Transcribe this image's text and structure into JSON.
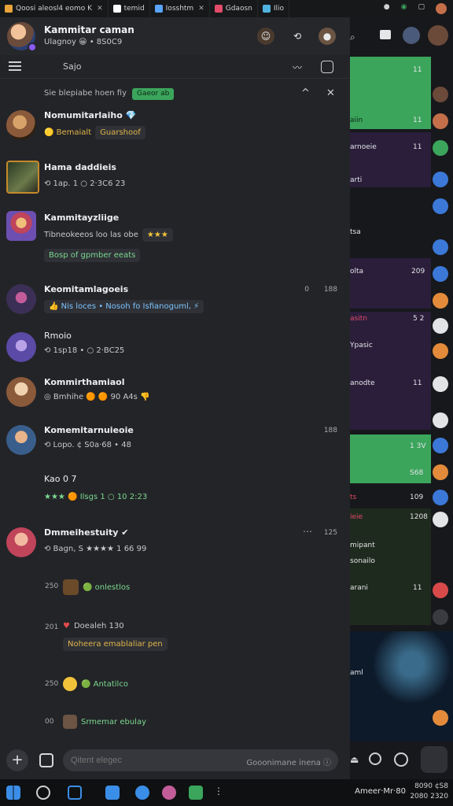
{
  "tabs": [
    {
      "label": "Qoosi aleosl4 eomo K",
      "color": "#e8a33a",
      "closable": true
    },
    {
      "label": "temid",
      "color": "#ffffff",
      "closable": false
    },
    {
      "label": "Iosshtm",
      "color": "#5aa3ff",
      "closable": true
    },
    {
      "label": "Gdaosn",
      "color": "#e34b6a",
      "closable": false
    },
    {
      "label": "Ilio",
      "color": "#4fb3e0",
      "closable": false
    }
  ],
  "header": {
    "title": "Kammitar caman",
    "subtitle": "Ulagnoy 😀 • 8S0C9",
    "buttons": [
      "user-icon",
      "link-icon",
      "profile-icon"
    ]
  },
  "toolbar": {
    "label": "Sajo"
  },
  "filter": {
    "label": "Sie blepiabe hoen fiy",
    "chip": "Gaeor ab",
    "collapse": "^",
    "close": "✕"
  },
  "messages": [
    {
      "name": "Nomumitarlaiho 💎",
      "line": "🟡 Bemaialt",
      "pill": "Guarshoof",
      "avatar": "#8a5a3a"
    },
    {
      "name": "Hama daddieis",
      "line": "⟲ 1ap. 1   ○ 2·3C6 23",
      "avatar": "#3b4a2c"
    },
    {
      "name": "Kammitayzliige",
      "line": "Tibneokeeos loo las obe",
      "pill": "Bosp of gpmber eeats",
      "avatar": "#6c4fb0"
    },
    {
      "name": "Keomitamlagoeis",
      "line": "👍 Nis loces • Nosoh fo Isfianoguml, ⚡",
      "time_a": "0",
      "time_b": "188",
      "avatar": "#3b2f56"
    },
    {
      "name": "Rmoio",
      "line": "⟲ 1sp18 •  ○ 2·BC25",
      "avatar": "#5b4aa6"
    },
    {
      "name": "Kommirthamiaol",
      "line": "◎ Bmhihe 🟠 🟠 90 A4s 👎",
      "avatar": "#c8a17a"
    },
    {
      "name": "Komemitarnuieoie",
      "line": "⟲ Lopo. ¢  S0a·68 • 48",
      "time": "188",
      "avatar": "#3a5e8c"
    },
    {
      "name": "Kao 0 7",
      "line": "★★★ 🟠 Ilsgs 1  ○ 10 2:23",
      "avatar": null
    },
    {
      "name": "Dmmeihestuity ✔",
      "line": "⟲ Bagn, S  ★★★★  1 66 99",
      "time": "125",
      "avatar": "#c0445a"
    }
  ],
  "mini_events": [
    {
      "ts": "250",
      "text": "🟢 onlestlos"
    },
    {
      "ts": "201",
      "text": "Doealeh 130",
      "pill": "Noheera emablaliar pen"
    },
    {
      "ts": "250",
      "text": "🟢 Antatilco"
    },
    {
      "ts": "00",
      "text": "Srmemar ebulay"
    }
  ],
  "composer": {
    "placeholder": "Qitent elegec",
    "hint": "Gooonimane inena ⓘ"
  },
  "right_panel": {
    "items": [
      {
        "text": "",
        "num": "11",
        "color": "#3ba55c"
      },
      {
        "text": "aiin",
        "num": "11",
        "color": "#3ba55c"
      },
      {
        "text": "arnoeie",
        "num": "11",
        "color": "#3b2556"
      },
      {
        "text": "arti",
        "num": "",
        "color": "#17181b"
      },
      {
        "text": "tsa",
        "num": "",
        "color": "#17181b"
      },
      {
        "text": "olta",
        "num": "209",
        "color": "#3b2556"
      },
      {
        "text": "asitn",
        "num": "5 2",
        "color": "#2a1e3b"
      },
      {
        "text": "Ypasic",
        "num": "",
        "color": "#2a1e3b"
      },
      {
        "text": "anodte",
        "num": "11",
        "color": "#2a1e3b"
      },
      {
        "text": "",
        "num": "1 3V",
        "color": "#3ba55c"
      },
      {
        "text": "",
        "num": "S68",
        "color": "#3ba55c"
      },
      {
        "text": "ts",
        "num": "109",
        "color": "#17181b"
      },
      {
        "text": "ieie",
        "num": "1208",
        "color": "#1f2a1e"
      },
      {
        "text": "mipant",
        "num": "",
        "color": "#1f2a1e"
      },
      {
        "text": "sonailo",
        "num": "",
        "color": "#1f2a1e"
      },
      {
        "text": "arani",
        "num": "11",
        "color": "#17181b"
      },
      {
        "text": "aml",
        "num": "",
        "color": "#0d1a2a"
      }
    ]
  },
  "taskbar": {
    "time": "Ameer·Mr·80",
    "date_lines": [
      "8090  ¢S8",
      "2080  2320"
    ],
    "icons": [
      "windows-icon",
      "search-icon",
      "files-icon",
      "chat-icon",
      "browser-icon",
      "app-icon",
      "game-icon",
      "more-icon"
    ]
  }
}
